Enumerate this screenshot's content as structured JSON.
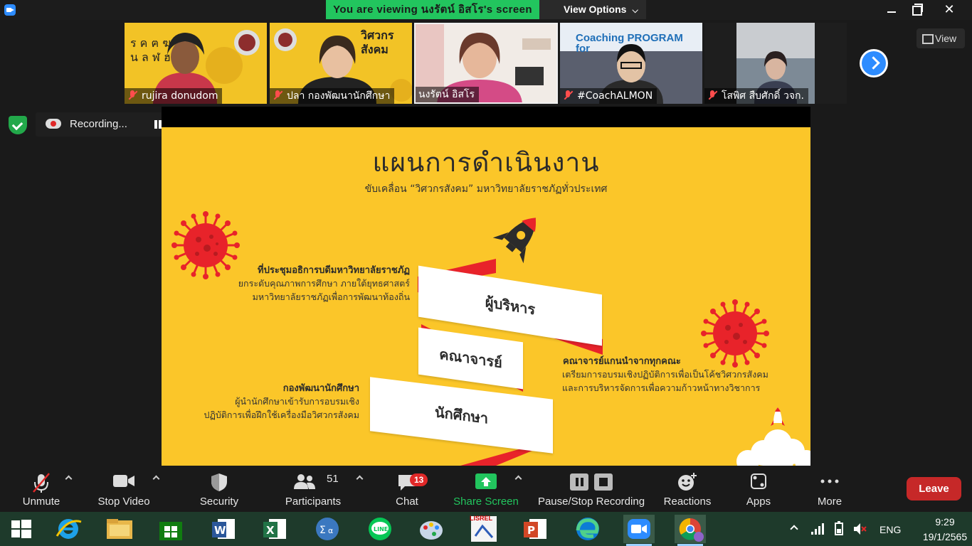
{
  "window": {
    "viewing_banner": "You are viewing นงรัตน์ อิสโร's screen",
    "view_options": "View Options"
  },
  "gallery": {
    "participants": [
      {
        "name": "rujira donudom",
        "muted": true
      },
      {
        "name": "ปลา กองพัฒนานักศึกษา",
        "muted": true
      },
      {
        "name": "นงรัตน์ อิสโร",
        "muted": false
      },
      {
        "name": "#CoachALMON",
        "muted": true
      },
      {
        "name": "โสพิศ สืบศักดิ์ วจก.",
        "muted": true
      }
    ],
    "thumb2_sign": "วิศวกร สังคม",
    "thumb4_banner": "Coaching PROGRAM for",
    "view_label": "View"
  },
  "recording": {
    "status": "Recording..."
  },
  "slide": {
    "title": "แผนการดำเนินงาน",
    "subtitle": "ขับเคลื่อน “วิศวกรสังคม” มหาวิทยาลัยราชภัฏทั่วประเทศ",
    "ribbon": [
      "ผู้บริหาร",
      "คณาจารย์",
      "นักศึกษา"
    ],
    "left_top": {
      "heading": "ที่ประชุมอธิการบดีมหาวิทยาลัยราชภัฏ",
      "line1": "ยกระดับคุณภาพการศึกษา ภายใต้ยุทธศาสตร์",
      "line2": "มหาวิทยาลัยราชภัฏเพื่อการพัฒนาท้องถิ่น"
    },
    "left_bottom": {
      "heading": "กองพัฒนานักศึกษา",
      "line1": "ผู้นำนักศึกษาเข้ารับการอบรมเชิง",
      "line2": "ปฏิบัติการเพื่อฝึกใช้เครื่องมือวิศวกรสังคม"
    },
    "right": {
      "heading": "คณาจารย์แกนนำจากทุกคณะ",
      "line1": "เตรียมการอบรมเชิงปฏิบัติการเพื่อเป็นโค้ชวิศวกรสังคม",
      "line2": "และการบริหารจัดการเพื่อความก้าวหน้าทางวิชาการ"
    },
    "colors": {
      "background": "#fbc629",
      "ribbon_red": "#e8232a",
      "ribbon_white": "#ffffff"
    }
  },
  "toolbar": {
    "unmute": "Unmute",
    "stop_video": "Stop Video",
    "security": "Security",
    "participants": "Participants",
    "participants_count": "51",
    "chat": "Chat",
    "chat_badge": "13",
    "share_screen": "Share Screen",
    "pause_stop": "Pause/Stop Recording",
    "reactions": "Reactions",
    "apps": "Apps",
    "more": "More",
    "leave": "Leave"
  },
  "taskbar": {
    "language": "ENG",
    "time": "9:29",
    "date": "19/1/2565",
    "lisrel_label": "LISREL",
    "icons": [
      "start-icon",
      "internet-explorer-icon",
      "file-explorer-icon",
      "store-icon",
      "word-icon",
      "excel-icon",
      "calculator-icon",
      "line-icon",
      "paint-icon",
      "lisrel-icon",
      "powerpoint-icon",
      "edge-icon",
      "zoom-icon",
      "chrome-icon"
    ]
  }
}
